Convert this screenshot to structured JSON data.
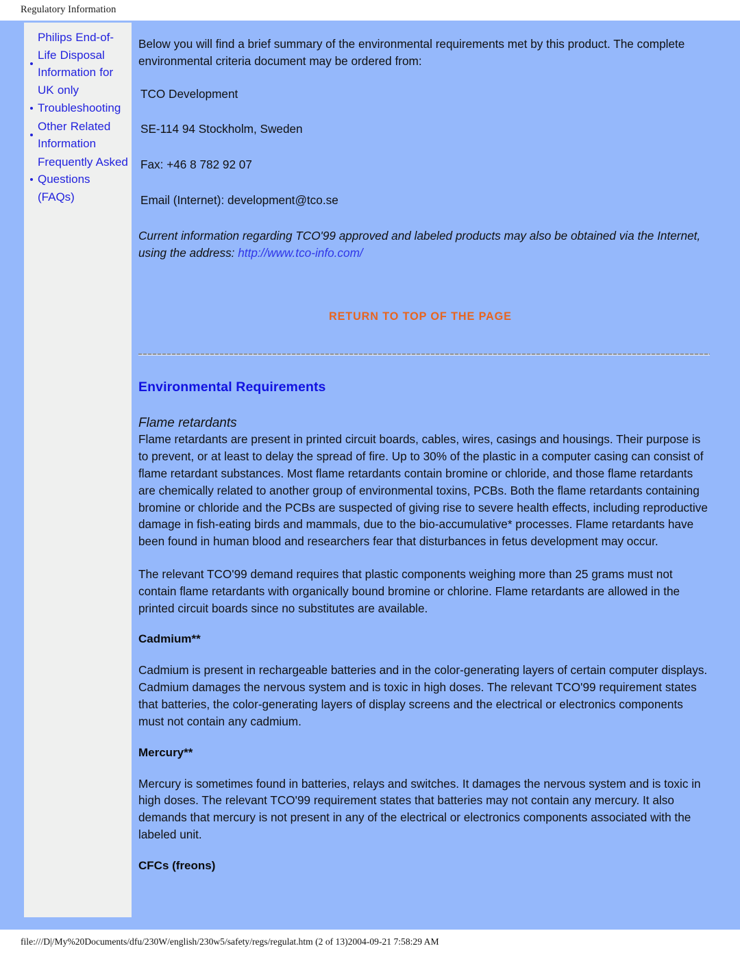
{
  "header": {
    "title": "Regulatory Information"
  },
  "sidebar": {
    "items": [
      {
        "label": "Philips End-of-Life Disposal Information for UK only"
      },
      {
        "label": "Troubleshooting"
      },
      {
        "label": "Other Related Information"
      },
      {
        "label": "Frequently Asked Questions (FAQs)"
      }
    ]
  },
  "content": {
    "intro": "Below you will find a brief summary of the environmental requirements met by this product. The complete environmental criteria document may be ordered from:",
    "address": {
      "organization": "TCO Development",
      "city_line": "SE-114 94 Stockholm, Sweden",
      "fax": "Fax: +46 8 782 92 07",
      "email": "Email (Internet): development@tco.se"
    },
    "note_italic_prefix": "Current information regarding TCO'99 approved and labeled products may also be obtained via the Internet, using the address: ",
    "note_link": "http://www.tco-info.com/",
    "return_to_top": "RETURN TO TOP OF THE PAGE",
    "section_title": "Environmental Requirements",
    "sub_title": "Flame retardants",
    "flame_para_1": "Flame retardants are present in printed circuit boards, cables, wires, casings and housings. Their purpose is to prevent, or at least to delay the spread of fire. Up to 30% of the plastic in a computer casing can consist of flame retardant substances. Most flame retardants contain bromine or chloride, and those flame retardants are chemically related to another group of environmental toxins, PCBs. Both the flame retardants containing bromine or chloride and the PCBs are suspected of giving rise to severe health effects, including reproductive damage in fish-eating birds and mammals, due to the bio-accumulative* processes. Flame retardants have been found in human blood and researchers fear that disturbances in fetus development may occur.",
    "flame_para_2": "The relevant TCO'99 demand requires that plastic components weighing more than 25 grams must not contain flame retardants with organically bound bromine or chlorine. Flame retardants are allowed in the printed circuit boards since no substitutes are available.",
    "cadmium_title": "Cadmium**",
    "cadmium_para": "Cadmium is present in rechargeable batteries and in the color-generating layers of certain computer displays. Cadmium damages the nervous system and is toxic in high doses. The relevant TCO'99 requirement states that batteries, the color-generating layers of display screens and the electrical or electronics components must not contain any cadmium.",
    "mercury_title": "Mercury**",
    "mercury_para": "Mercury is sometimes found in batteries, relays and switches. It damages the nervous system and is toxic in high doses. The relevant TCO'99 requirement states that batteries may not contain any mercury. It also demands that mercury is not present in any of the electrical or electronics components associated with the labeled unit.",
    "cfc_title": "CFCs (freons)"
  },
  "footer": {
    "path_text": "file:///D|/My%20Documents/dfu/230W/english/230w5/safety/regs/regulat.htm (2 of 13)2004-09-21 7:58:29 AM"
  },
  "colors": {
    "page_background": "#95b8fb",
    "sidebar_background": "#eff0ef",
    "link_blue": "#2222dd",
    "accent_orange": "#e8641e",
    "heading_blue": "#1111e0"
  }
}
